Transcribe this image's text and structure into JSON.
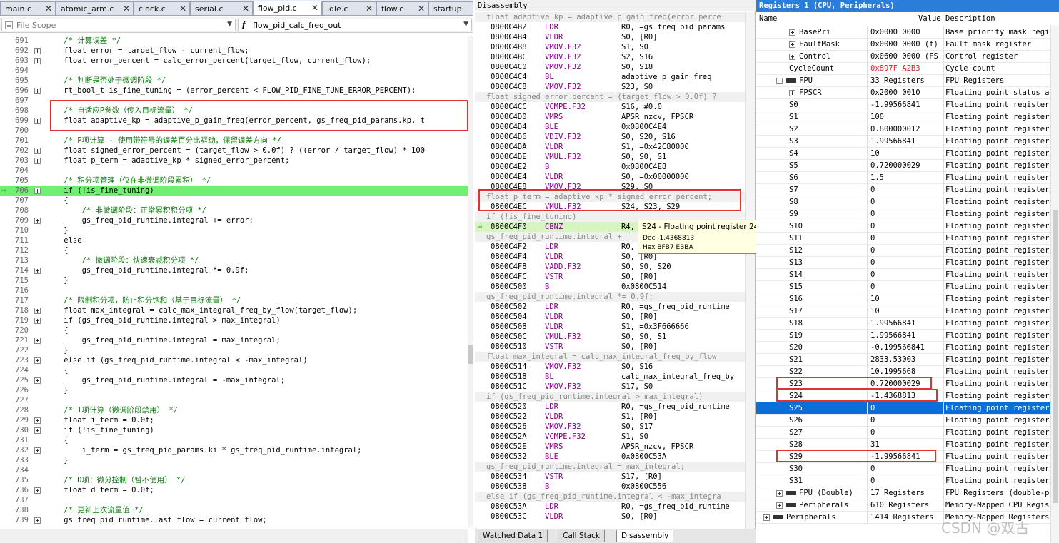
{
  "editor": {
    "tabs": [
      "main.c",
      "atomic_arm.c",
      "clock.c",
      "serial.c",
      "flow_pid.c",
      "idle.c",
      "flow.c",
      "startup"
    ],
    "active_tab": "flow_pid.c",
    "scope_label": "File Scope",
    "function_label": "flow_pid_calc_freq_out",
    "lines": [
      {
        "n": "691",
        "t": "/* 计算误差 */",
        "c": true
      },
      {
        "n": "692",
        "t": "float error = target_flow - current_flow;"
      },
      {
        "n": "693",
        "t": "float error_percent = calc_error_percent(target_flow, current_flow);"
      },
      {
        "n": "694",
        "t": ""
      },
      {
        "n": "695",
        "t": "/* 判断是否处于微调阶段 */",
        "c": true
      },
      {
        "n": "696",
        "t": "rt_bool_t is_fine_tuning = (error_percent < FLOW_PID_FINE_TUNE_ERROR_PERCENT);"
      },
      {
        "n": "697",
        "t": ""
      },
      {
        "n": "698",
        "t": "/* 自适应P参数（传入目标流量） */",
        "c": true
      },
      {
        "n": "699",
        "t": "float adaptive_kp = adaptive_p_gain_freq(error_percent, gs_freq_pid_params.kp, t"
      },
      {
        "n": "700",
        "t": ""
      },
      {
        "n": "701",
        "t": "/* P项计算 - 使用带符号的误差百分比驱动，保留误差方向 */",
        "c": true
      },
      {
        "n": "702",
        "t": "float signed_error_percent = (target_flow > 0.0f) ? ((error / target_flow) * 100"
      },
      {
        "n": "703",
        "t": "float p_term = adaptive_kp * signed_error_percent;"
      },
      {
        "n": "704",
        "t": ""
      },
      {
        "n": "705",
        "t": "/* 积分项管理（仅在非微调阶段累积） */",
        "c": true
      },
      {
        "n": "706",
        "t": "if (!is_fine_tuning)",
        "exec": true
      },
      {
        "n": "707",
        "t": "{"
      },
      {
        "n": "708",
        "t": "    /* 非微调阶段：正常累积积分项 */",
        "c": true
      },
      {
        "n": "709",
        "t": "    gs_freq_pid_runtime.integral += error;"
      },
      {
        "n": "710",
        "t": "}"
      },
      {
        "n": "711",
        "t": "else"
      },
      {
        "n": "712",
        "t": "{"
      },
      {
        "n": "713",
        "t": "    /* 微调阶段：快速衰减积分项 */",
        "c": true
      },
      {
        "n": "714",
        "t": "    gs_freq_pid_runtime.integral *= 0.9f;"
      },
      {
        "n": "715",
        "t": "}"
      },
      {
        "n": "716",
        "t": ""
      },
      {
        "n": "717",
        "t": "/* 限制积分项，防止积分饱和（基于目标流量） */",
        "c": true
      },
      {
        "n": "718",
        "t": "float max_integral = calc_max_integral_freq_by_flow(target_flow);"
      },
      {
        "n": "719",
        "t": "if (gs_freq_pid_runtime.integral > max_integral)"
      },
      {
        "n": "720",
        "t": "{"
      },
      {
        "n": "721",
        "t": "    gs_freq_pid_runtime.integral = max_integral;"
      },
      {
        "n": "722",
        "t": "}"
      },
      {
        "n": "723",
        "t": "else if (gs_freq_pid_runtime.integral < -max_integral)"
      },
      {
        "n": "724",
        "t": "{"
      },
      {
        "n": "725",
        "t": "    gs_freq_pid_runtime.integral = -max_integral;"
      },
      {
        "n": "726",
        "t": "}"
      },
      {
        "n": "727",
        "t": ""
      },
      {
        "n": "728",
        "t": "/* I项计算（微调阶段禁用） */",
        "c": true
      },
      {
        "n": "729",
        "t": "float i_term = 0.0f;"
      },
      {
        "n": "730",
        "t": "if (!is_fine_tuning)"
      },
      {
        "n": "731",
        "t": "{"
      },
      {
        "n": "732",
        "t": "    i_term = gs_freq_pid_params.ki * gs_freq_pid_runtime.integral;"
      },
      {
        "n": "733",
        "t": "}"
      },
      {
        "n": "734",
        "t": ""
      },
      {
        "n": "735",
        "t": "/* D项：微分控制（暂不使用） */",
        "c": true
      },
      {
        "n": "736",
        "t": "float d_term = 0.0f;"
      },
      {
        "n": "737",
        "t": ""
      },
      {
        "n": "738",
        "t": "/* 更新上次流量值 */",
        "c": true
      },
      {
        "n": "739",
        "t": "gs_freq_pid_runtime.last_flow = current_flow;"
      }
    ]
  },
  "disassembly": {
    "title": "Disassembly",
    "rows": [
      {
        "s": "float adaptive_kp = adaptive_p_gain_freq(error_perce"
      },
      {
        "a": "0800C4B2",
        "m": "LDR",
        "o": "R0, =gs_freq_pid_params"
      },
      {
        "a": "0800C4B4",
        "m": "VLDR",
        "o": "S0, [R0]"
      },
      {
        "a": "0800C4B8",
        "m": "VMOV.F32",
        "o": "S1, S0"
      },
      {
        "a": "0800C4BC",
        "m": "VMOV.F32",
        "o": "S2, S16"
      },
      {
        "a": "0800C4C0",
        "m": "VMOV.F32",
        "o": "S0, S18"
      },
      {
        "a": "0800C4C4",
        "m": "BL",
        "o": "adaptive_p_gain_freq"
      },
      {
        "a": "0800C4C8",
        "m": "VMOV.F32",
        "o": "S23, S0"
      },
      {
        "s": "float signed_error_percent = (target_flow > 0.0f) ?"
      },
      {
        "a": "0800C4CC",
        "m": "VCMPE.F32",
        "o": "S16, #0.0"
      },
      {
        "a": "0800C4D0",
        "m": "VMRS",
        "o": "APSR_nzcv, FPSCR"
      },
      {
        "a": "0800C4D4",
        "m": "BLE",
        "o": "0x0800C4E4"
      },
      {
        "a": "0800C4D6",
        "m": "VDIV.F32",
        "o": "S0, S20, S16"
      },
      {
        "a": "0800C4DA",
        "m": "VLDR",
        "o": "S1, =0x42C80000"
      },
      {
        "a": "0800C4DE",
        "m": "VMUL.F32",
        "o": "S0, S0, S1"
      },
      {
        "a": "0800C4E2",
        "m": "B",
        "o": "0x0800C4E8"
      },
      {
        "a": "0800C4E4",
        "m": "VLDR",
        "o": "S0, =0x00000000"
      },
      {
        "a": "0800C4E8",
        "m": "VMOV.F32",
        "o": "S29, S0"
      },
      {
        "s": "float p_term = adaptive_kp * signed_error_percent;"
      },
      {
        "a": "0800C4EC",
        "m": "VMUL.F32",
        "o": "S24, S23, S29"
      },
      {
        "s": "if (!is_fine_tuning)"
      },
      {
        "a": "0800C4F0",
        "m": "CBNZ",
        "o": "R4,",
        "cur": true
      },
      {
        "s": "gs_freq_pid_runtime.integral +"
      },
      {
        "a": "0800C4F2",
        "m": "LDR",
        "o": "R0,"
      },
      {
        "a": "0800C4F4",
        "m": "VLDR",
        "o": "S0, [R0]"
      },
      {
        "a": "0800C4F8",
        "m": "VADD.F32",
        "o": "S0, S0, S20"
      },
      {
        "a": "0800C4FC",
        "m": "VSTR",
        "o": "S0, [R0]"
      },
      {
        "a": "0800C500",
        "m": "B",
        "o": "0x0800C514"
      },
      {
        "s": "gs_freq_pid_runtime.integral *= 0.9f;"
      },
      {
        "a": "0800C502",
        "m": "LDR",
        "o": "R0, =gs_freq_pid_runtime"
      },
      {
        "a": "0800C504",
        "m": "VLDR",
        "o": "S0, [R0]"
      },
      {
        "a": "0800C508",
        "m": "VLDR",
        "o": "S1, =0x3F666666"
      },
      {
        "a": "0800C50C",
        "m": "VMUL.F32",
        "o": "S0, S0, S1"
      },
      {
        "a": "0800C510",
        "m": "VSTR",
        "o": "S0, [R0]"
      },
      {
        "s": "float max_integral = calc_max_integral_freq_by_flow"
      },
      {
        "a": "0800C514",
        "m": "VMOV.F32",
        "o": "S0, S16"
      },
      {
        "a": "0800C518",
        "m": "BL",
        "o": "calc_max_integral_freq_by"
      },
      {
        "a": "0800C51C",
        "m": "VMOV.F32",
        "o": "S17, S0"
      },
      {
        "s": "if (gs_freq_pid_runtime.integral > max_integral)"
      },
      {
        "a": "0800C520",
        "m": "LDR",
        "o": "R0, =gs_freq_pid_runtime"
      },
      {
        "a": "0800C522",
        "m": "VLDR",
        "o": "S1, [R0]"
      },
      {
        "a": "0800C526",
        "m": "VMOV.F32",
        "o": "S0, S17"
      },
      {
        "a": "0800C52A",
        "m": "VCMPE.F32",
        "o": "S1, S0"
      },
      {
        "a": "0800C52E",
        "m": "VMRS",
        "o": "APSR_nzcv, FPSCR"
      },
      {
        "a": "0800C532",
        "m": "BLE",
        "o": "0x0800C53A"
      },
      {
        "s": "gs_freq_pid_runtime.integral = max_integral;"
      },
      {
        "a": "0800C534",
        "m": "VSTR",
        "o": "S17, [R0]"
      },
      {
        "a": "0800C538",
        "m": "B",
        "o": "0x0800C556"
      },
      {
        "s": "else if (gs_freq_pid_runtime.integral < -max_integra"
      },
      {
        "a": "0800C53A",
        "m": "LDR",
        "o": "R0, =gs_freq_pid_runtime"
      },
      {
        "a": "0800C53C",
        "m": "VLDR",
        "o": "S0, [R0]"
      }
    ],
    "tooltip": {
      "header": "S24 - Floating point register 24",
      "dec": "Dec -1.4368813",
      "hex": "Hex BFB7 EBBA"
    },
    "bottom_tabs": [
      "Watched Data 1",
      "Call Stack",
      "Disassembly"
    ]
  },
  "registers": {
    "title": "Registers 1 (CPU, Peripherals)",
    "col_name": "Name",
    "col_value": "Value",
    "col_desc": "Description",
    "rows": [
      {
        "n": "BasePri",
        "v": "0x0000 0000",
        "d": "Base priority mask regis",
        "ind": 2,
        "exp": "plus"
      },
      {
        "n": "FaultMask",
        "v": "0x0000 0000 (f)",
        "d": "Fault mask register",
        "ind": 2,
        "exp": "plus"
      },
      {
        "n": "Control",
        "v": "0x0600 0000 (FS",
        "d": "Control register",
        "ind": 2,
        "exp": "plus"
      },
      {
        "n": "CycleCount",
        "v": "0x897F A2B3",
        "d": "Cycle count",
        "ind": 3,
        "red": true
      },
      {
        "n": "FPU",
        "v": "33 Registers",
        "d": "FPU Registers",
        "ind": 1,
        "exp": "minus",
        "chip": true
      },
      {
        "n": "FPSCR",
        "v": "0x2000 0010",
        "d": "Floating point status an",
        "ind": 2,
        "exp": "plus"
      },
      {
        "n": "S0",
        "v": "-1.99566841",
        "d": "Floating point register",
        "ind": 3
      },
      {
        "n": "S1",
        "v": "100",
        "d": "Floating point register",
        "ind": 3
      },
      {
        "n": "S2",
        "v": "0.800000012",
        "d": "Floating point register",
        "ind": 3
      },
      {
        "n": "S3",
        "v": "1.99566841",
        "d": "Floating point register",
        "ind": 3
      },
      {
        "n": "S4",
        "v": "10",
        "d": "Floating point register",
        "ind": 3
      },
      {
        "n": "S5",
        "v": "0.720000029",
        "d": "Floating point register",
        "ind": 3
      },
      {
        "n": "S6",
        "v": "1.5",
        "d": "Floating point register",
        "ind": 3
      },
      {
        "n": "S7",
        "v": "0",
        "d": "Floating point register",
        "ind": 3
      },
      {
        "n": "S8",
        "v": "0",
        "d": "Floating point register",
        "ind": 3
      },
      {
        "n": "S9",
        "v": "0",
        "d": "Floating point register",
        "ind": 3
      },
      {
        "n": "S10",
        "v": "0",
        "d": "Floating point register",
        "ind": 3
      },
      {
        "n": "S11",
        "v": "0",
        "d": "Floating point register",
        "ind": 3
      },
      {
        "n": "S12",
        "v": "0",
        "d": "Floating point register",
        "ind": 3
      },
      {
        "n": "S13",
        "v": "0",
        "d": "Floating point register",
        "ind": 3
      },
      {
        "n": "S14",
        "v": "0",
        "d": "Floating point register",
        "ind": 3
      },
      {
        "n": "S15",
        "v": "0",
        "d": "Floating point register",
        "ind": 3
      },
      {
        "n": "S16",
        "v": "10",
        "d": "Floating point register",
        "ind": 3
      },
      {
        "n": "S17",
        "v": "10",
        "d": "Floating point register",
        "ind": 3
      },
      {
        "n": "S18",
        "v": "1.99566841",
        "d": "Floating point register",
        "ind": 3
      },
      {
        "n": "S19",
        "v": "1.99566841",
        "d": "Floating point register",
        "ind": 3
      },
      {
        "n": "S20",
        "v": "-0.199566841",
        "d": "Floating point register",
        "ind": 3
      },
      {
        "n": "S21",
        "v": "2833.53003",
        "d": "Floating point register",
        "ind": 3
      },
      {
        "n": "S22",
        "v": "10.1995668",
        "d": "Floating point register",
        "ind": 3
      },
      {
        "n": "S23",
        "v": "0.720000029",
        "d": "Floating point register",
        "ind": 3
      },
      {
        "n": "S24",
        "v": "-1.4368813",
        "d": "Floating point register",
        "ind": 3
      },
      {
        "n": "S25",
        "v": "0",
        "d": "Floating point register",
        "ind": 3,
        "sel": true
      },
      {
        "n": "S26",
        "v": "0",
        "d": "Floating point register",
        "ind": 3
      },
      {
        "n": "S27",
        "v": "0",
        "d": "Floating point register",
        "ind": 3
      },
      {
        "n": "S28",
        "v": "31",
        "d": "Floating point register",
        "ind": 3
      },
      {
        "n": "S29",
        "v": "-1.99566841",
        "d": "Floating point register",
        "ind": 3
      },
      {
        "n": "S30",
        "v": "0",
        "d": "Floating point register",
        "ind": 3
      },
      {
        "n": "S31",
        "v": "0",
        "d": "Floating point register",
        "ind": 3
      },
      {
        "n": "FPU (Double)",
        "v": "17 Registers",
        "d": "FPU Registers (double-pr",
        "ind": 1,
        "exp": "plus",
        "chip": true
      },
      {
        "n": "Peripherals",
        "v": "610 Registers",
        "d": "Memory-Mapped CPU Regist",
        "ind": 1,
        "exp": "plus",
        "chip": true
      },
      {
        "n": "Peripherals",
        "v": "1414 Registers",
        "d": "Memory-Mapped Registers",
        "ind": 0,
        "exp": "plus",
        "chip": true
      }
    ]
  },
  "watermark": "CSDN @双古"
}
